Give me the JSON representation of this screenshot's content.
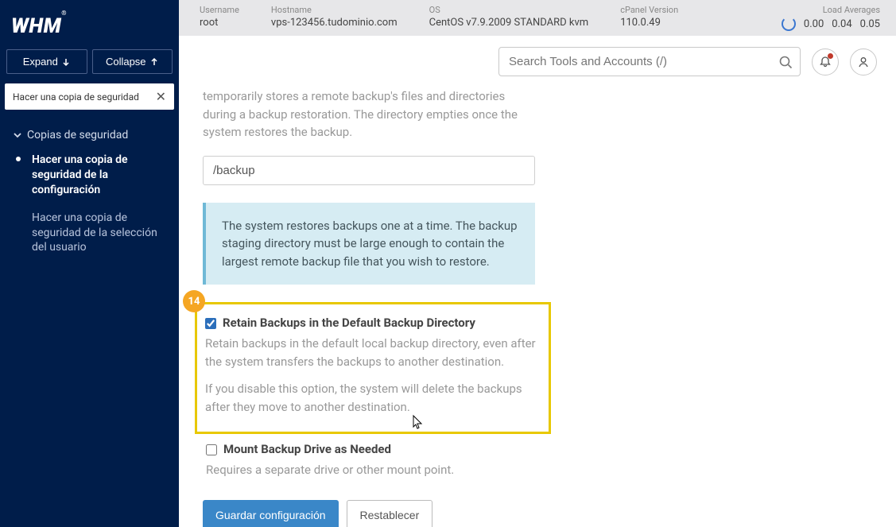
{
  "sidebar": {
    "logo": "WHM",
    "expand": "Expand",
    "collapse": "Collapse",
    "breadcrumb": "Hacer una copia de seguridad",
    "section_title": "Copias de seguridad",
    "items": [
      {
        "label": "Hacer una copia de seguridad de la configuración",
        "active": true
      },
      {
        "label": "Hacer una copia de seguridad de la selección del usuario",
        "active": false
      }
    ]
  },
  "topbar": {
    "username_label": "Username",
    "username_value": "root",
    "hostname_label": "Hostname",
    "hostname_value": "vps-123456.tudominio.com",
    "os_label": "OS",
    "os_value": "CentOS v7.9.2009 STANDARD kvm",
    "cpver_label": "cPanel Version",
    "cpver_value": "110.0.49",
    "load_label": "Load Averages",
    "load_values": [
      "0.00",
      "0.04",
      "0.05"
    ]
  },
  "search": {
    "placeholder": "Search Tools and Accounts (/)"
  },
  "content": {
    "staging_desc": "temporarily stores a remote backup's files and directories during a backup restoration. The directory empties once the system restores the backup.",
    "staging_path": "/backup",
    "info_text": "The system restores backups one at a time. The backup staging directory must be large enough to contain the largest remote backup file that you wish to restore.",
    "badge": "14",
    "retain_label": "Retain Backups in the Default Backup Directory",
    "retain_desc1": "Retain backups in the default local backup directory, even after the system transfers the backups to another destination.",
    "retain_desc2": "If you disable this option, the system will delete the backups after they move to another destination.",
    "mount_label": "Mount Backup Drive as Needed",
    "mount_desc": "Requires a separate drive or other mount point.",
    "save_btn": "Guardar configuración",
    "reset_btn": "Restablecer"
  }
}
